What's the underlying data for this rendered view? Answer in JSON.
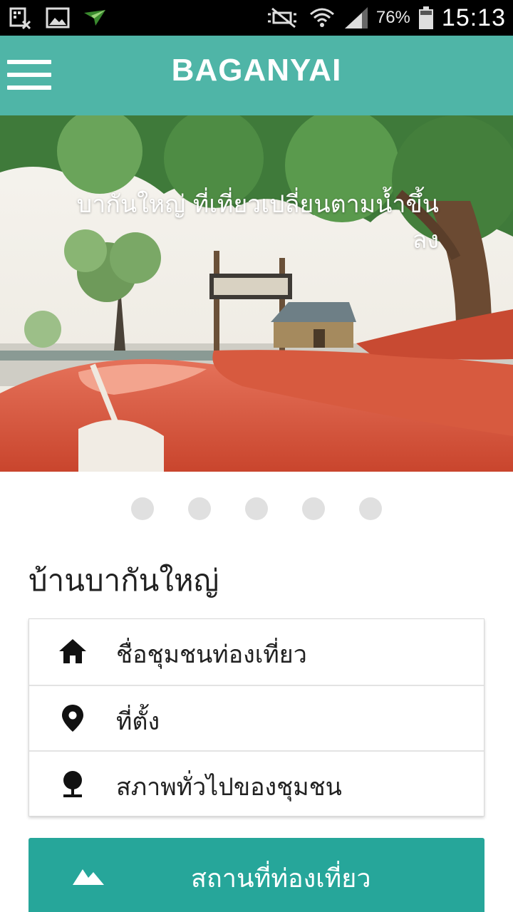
{
  "status_bar": {
    "battery": "76%",
    "time": "15:13",
    "icons": [
      "screenshot-icon",
      "image-icon",
      "paper-plane-icon",
      "mute-icon",
      "wifi-icon",
      "signal-icon",
      "battery-icon"
    ]
  },
  "app_bar": {
    "title": "BAGANYAI",
    "menu_icon": "hamburger-menu-icon"
  },
  "hero": {
    "caption": "บากันใหญ่ ที่เที่ยวเปลี่ยนตามน้ำขึ้นลง",
    "slide_count": 5
  },
  "village": {
    "title": "บ้านบากันใหญ่"
  },
  "info_list": [
    {
      "label": "ชื่อชุมชนท่องเที่ยว",
      "icon": "home-icon"
    },
    {
      "label": "ที่ตั้ง",
      "icon": "location-pin-icon"
    },
    {
      "label": "สภาพทั่วไปของชุมชน",
      "icon": "tree-icon"
    }
  ],
  "tour_button": {
    "label": "สถานที่ท่องเที่ยว",
    "icon": "mountain-icon"
  },
  "colors": {
    "app_bar": "#4fb5a7",
    "button": "#26a69a",
    "dot": "#e0e0e0",
    "kayak": "#d9583e"
  }
}
